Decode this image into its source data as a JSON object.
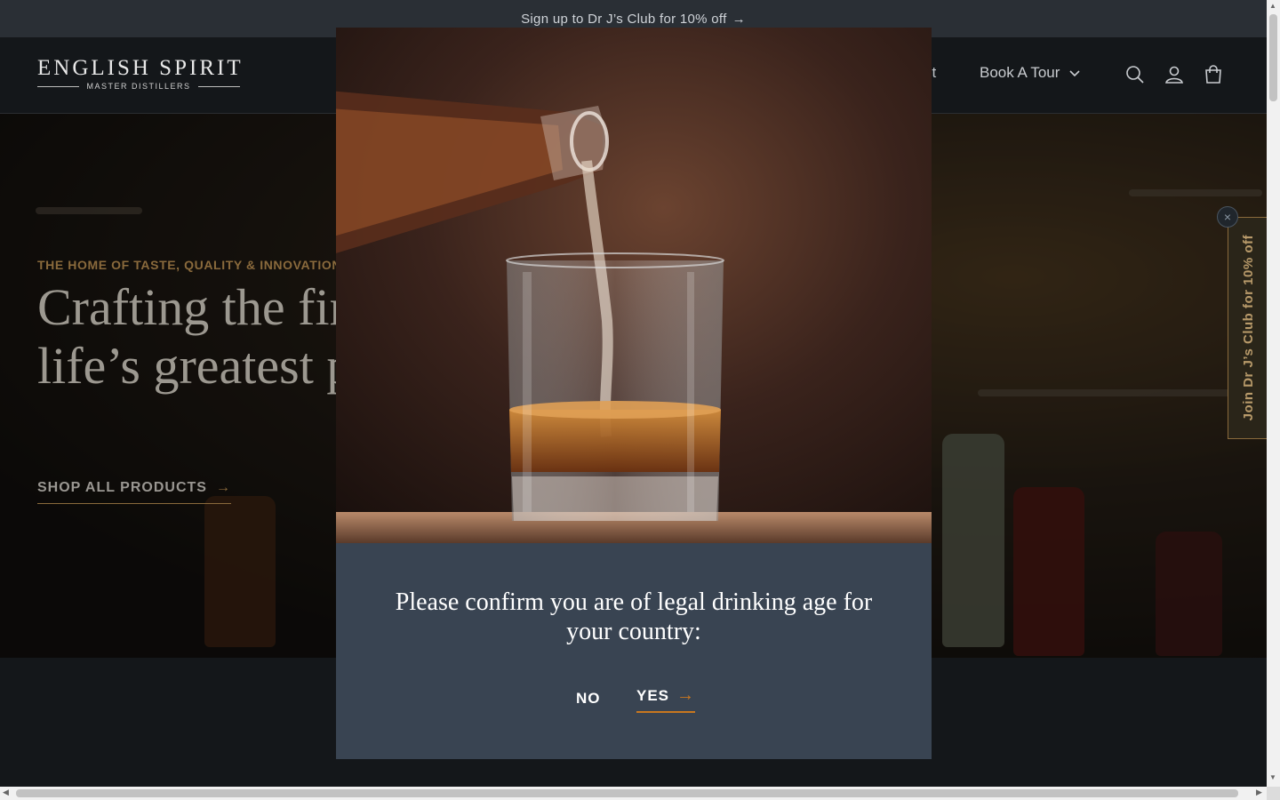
{
  "announcement": {
    "text": "Sign up to Dr J’s Club for 10% off",
    "arrow": "→"
  },
  "header": {
    "logo_main": "ENGLISH SPIRIT",
    "logo_sub": "MASTER DISTILLERS",
    "nav_partial": "ct",
    "nav_tour": "Book A Tour",
    "icons": [
      "search-icon",
      "account-icon",
      "cart-icon"
    ]
  },
  "hero": {
    "eyebrow": "THE HOME OF TASTE, QUALITY & INNOVATION",
    "headline": "Crafting the finest spirits for one of life’s greatest pleasures",
    "cta": "SHOP ALL PRODUCTS",
    "cta_arrow": "→"
  },
  "side_tab": {
    "label": "Join Dr J’s Club for 10% off",
    "close": "×"
  },
  "modal": {
    "question": "Please confirm you are of legal drinking age for your country:",
    "no_label": "NO",
    "yes_label": "YES",
    "yes_arrow": "→"
  },
  "colors": {
    "accent": "#c8771f",
    "modal_bg": "#394452",
    "header_bg": "#14171a",
    "announce_bg": "#2a2f35"
  }
}
